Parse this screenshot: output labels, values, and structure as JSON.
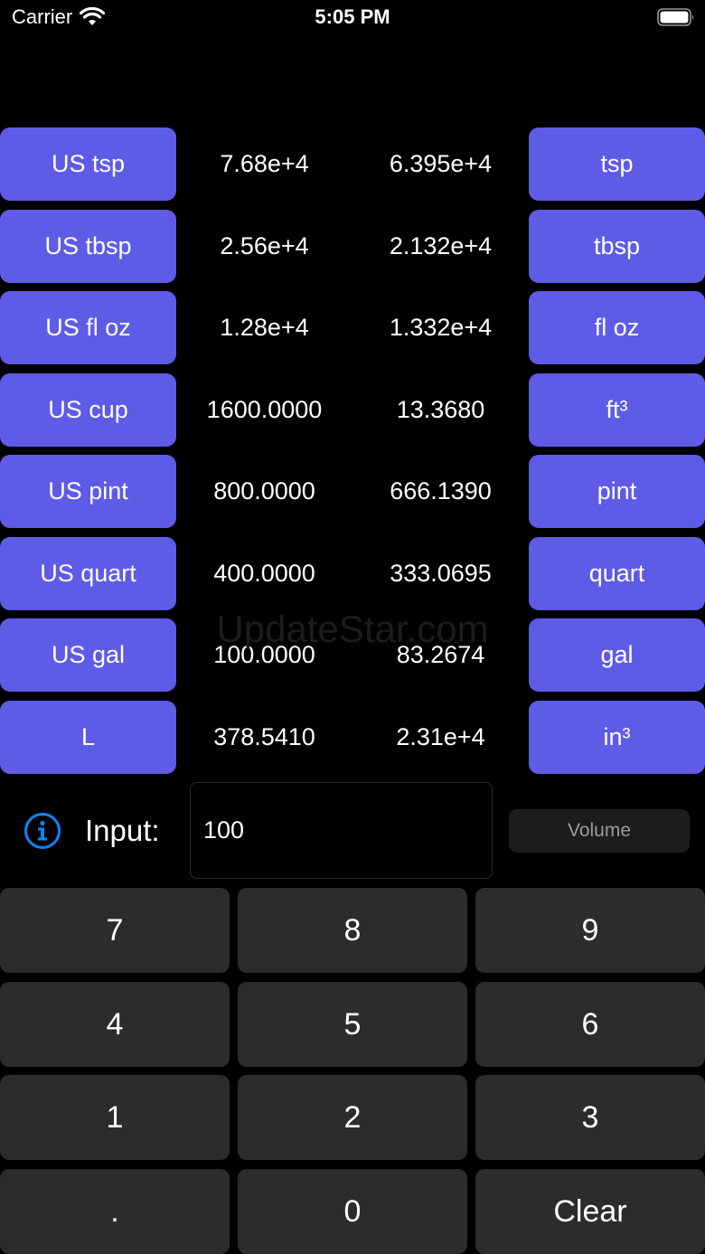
{
  "status_bar": {
    "carrier": "Carrier",
    "time": "5:05 PM"
  },
  "rows": [
    {
      "left_unit": "US tsp",
      "left_value": "7.68e+4",
      "right_value": "6.395e+4",
      "right_unit": "tsp"
    },
    {
      "left_unit": "US tbsp",
      "left_value": "2.56e+4",
      "right_value": "2.132e+4",
      "right_unit": "tbsp"
    },
    {
      "left_unit": "US fl oz",
      "left_value": "1.28e+4",
      "right_value": "1.332e+4",
      "right_unit": "fl oz"
    },
    {
      "left_unit": "US cup",
      "left_value": "1600.0000",
      "right_value": "13.3680",
      "right_unit": "ft³"
    },
    {
      "left_unit": "US pint",
      "left_value": "800.0000",
      "right_value": "666.1390",
      "right_unit": "pint"
    },
    {
      "left_unit": "US quart",
      "left_value": "400.0000",
      "right_value": "333.0695",
      "right_unit": "quart"
    },
    {
      "left_unit": "US gal",
      "left_value": "100.0000",
      "right_value": "83.2674",
      "right_unit": "gal"
    },
    {
      "left_unit": "L",
      "left_value": "378.5410",
      "right_value": "2.31e+4",
      "right_unit": "in³"
    }
  ],
  "watermark": "UpdateStar.com",
  "input": {
    "label": "Input:",
    "value": "100"
  },
  "mode_button": "Volume",
  "keypad": [
    "7",
    "8",
    "9",
    "4",
    "5",
    "6",
    "1",
    "2",
    "3",
    ".",
    "0",
    "Clear"
  ],
  "colors": {
    "accent": "#5e5ce6",
    "info_icon": "#0a84ff",
    "key_background": "#2c2c2e",
    "background": "#000000"
  }
}
